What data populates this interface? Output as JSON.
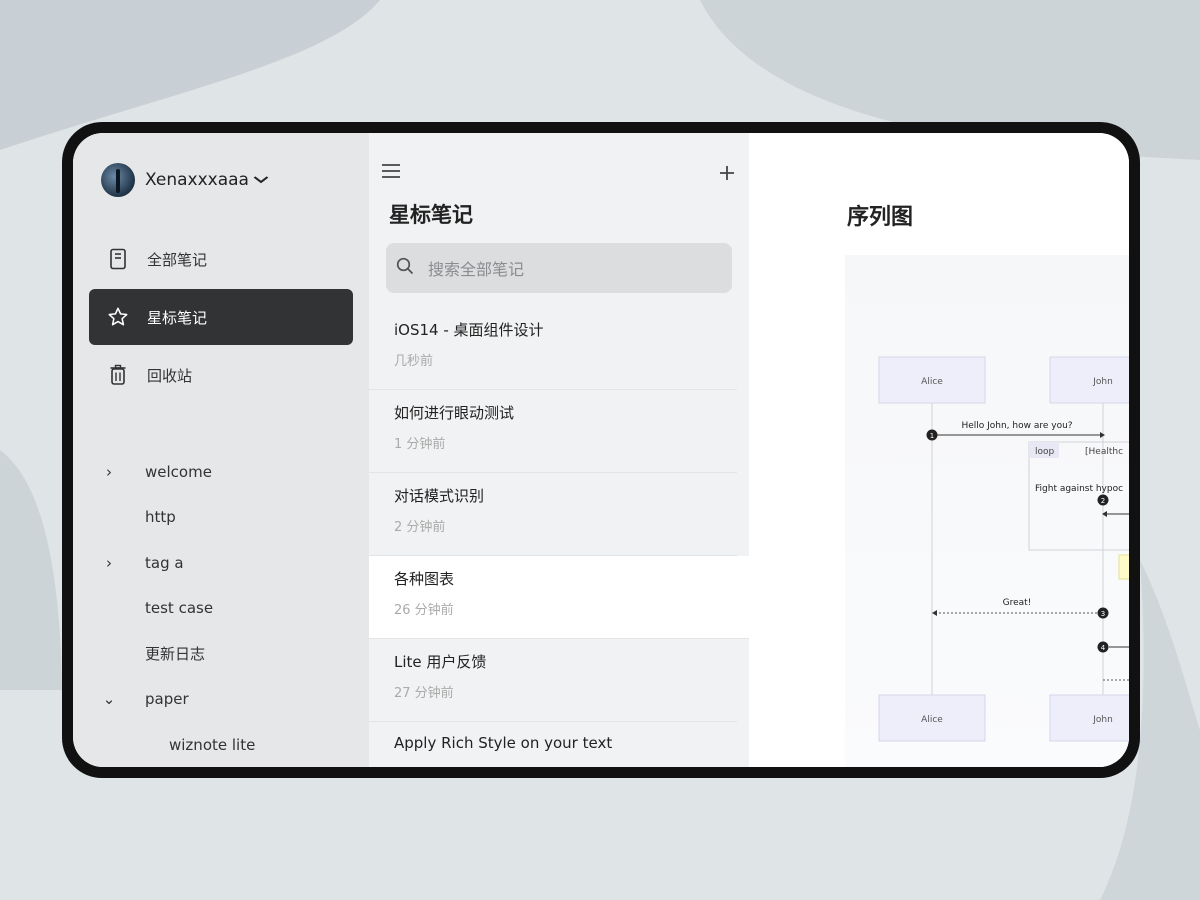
{
  "account": {
    "name": "Xenaxxxaaa"
  },
  "nav": [
    {
      "label": "全部笔记",
      "icon": "document-icon",
      "active": false
    },
    {
      "label": "星标笔记",
      "icon": "star-icon",
      "active": true
    },
    {
      "label": "回收站",
      "icon": "trash-icon",
      "active": false
    }
  ],
  "folders": [
    {
      "label": "welcome",
      "caret": "›"
    },
    {
      "label": "http",
      "caret": ""
    },
    {
      "label": "tag a",
      "caret": "›"
    },
    {
      "label": "test case",
      "caret": ""
    },
    {
      "label": "更新日志",
      "caret": ""
    },
    {
      "label": "paper",
      "caret": "⌄"
    },
    {
      "label": "wiznote lite",
      "caret": ""
    }
  ],
  "list": {
    "title": "星标笔记",
    "search_placeholder": "搜索全部笔记",
    "notes": [
      {
        "title": "iOS14 - 桌面组件设计",
        "time": "几秒前"
      },
      {
        "title": "如何进行眼动测试",
        "time": "1 分钟前"
      },
      {
        "title": "对话模式识别",
        "time": "2 分钟前"
      },
      {
        "title": "各种图表",
        "time": "26 分钟前"
      },
      {
        "title": "Lite 用户反馈",
        "time": "27 分钟前"
      },
      {
        "title": "Apply Rich Style on your text",
        "time": ""
      }
    ]
  },
  "editor": {
    "title": "序列图",
    "diagram": {
      "participant_top_1": "Alice",
      "participant_top_2": "John",
      "participant_bottom_1": "Alice",
      "participant_bottom_2": "John",
      "msg_1": "Hello John, how are you?",
      "loop_tag": "loop",
      "loop_cond": "[Healthc",
      "note_text": "Fight against hypoc",
      "msg_great": "Great!",
      "num_1": "1",
      "num_2": "2",
      "num_3": "3",
      "num_4": "4"
    }
  },
  "colors": {
    "active_nav": "#323335",
    "participant_fill": "#eeeefb",
    "note_fill": "#fffbc8"
  }
}
